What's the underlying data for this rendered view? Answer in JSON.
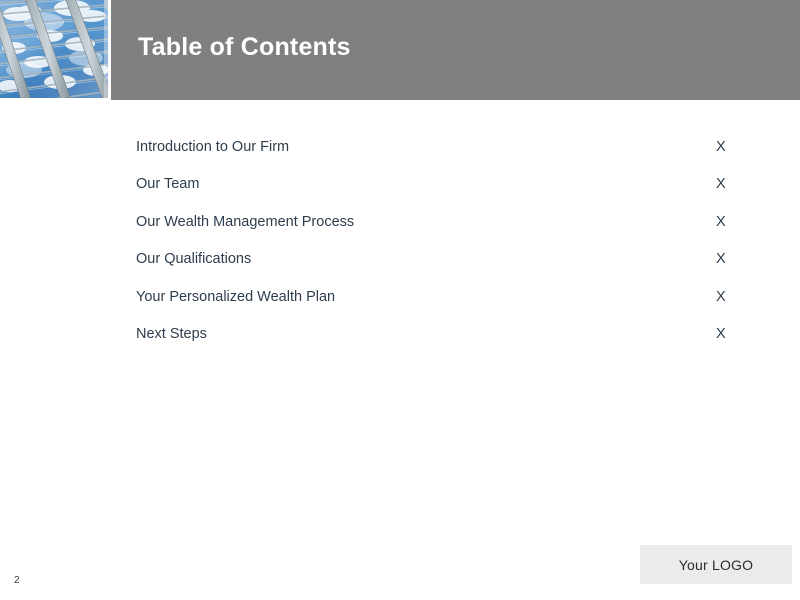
{
  "slide": {
    "page_number": "2",
    "background_color": "#ffffff"
  },
  "header": {
    "title": "Table of Contents",
    "bar_color": "#808080",
    "title_color": "#ffffff",
    "image": {
      "icon_name": "glass-roof-photo",
      "description": "Glass canopy roof with steel beams against blue sky and clouds",
      "sky_color": "#3a7fc0",
      "beam_color": "#7f8e96",
      "cloud_color": "#ffffff"
    }
  },
  "toc": {
    "text_color": "#2e3d4d",
    "items": [
      {
        "label": "Introduction to Our Firm",
        "page": "X"
      },
      {
        "label": "Our Team",
        "page": "X"
      },
      {
        "label": "Our Wealth Management Process",
        "page": "X"
      },
      {
        "label": "Our Qualifications",
        "page": "X"
      },
      {
        "label": "Your Personalized Wealth Plan",
        "page": "X"
      },
      {
        "label": "Next Steps",
        "page": "X"
      }
    ]
  },
  "footer": {
    "logo_placeholder": "Your LOGO",
    "logo_box_color": "#ebebeb"
  }
}
